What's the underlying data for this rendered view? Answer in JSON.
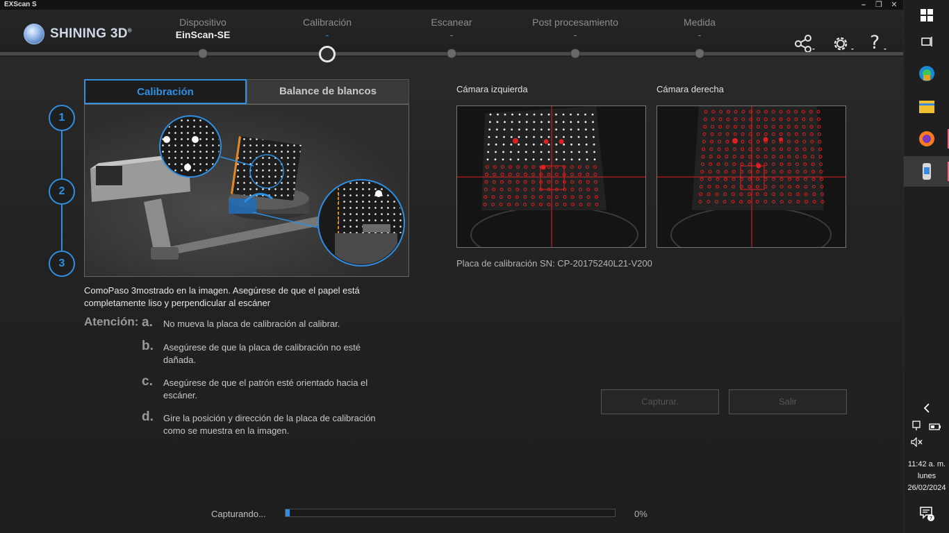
{
  "window": {
    "title": "EXScan S"
  },
  "header": {
    "brand": "SHINING 3D",
    "brand_mark": "®",
    "steps": [
      {
        "label": "Dispositivo",
        "value": "EinScan-SE"
      },
      {
        "label": "Calibración",
        "value": "-"
      },
      {
        "label": "Escanear",
        "value": "-"
      },
      {
        "label": "Post procesamiento",
        "value": "-"
      },
      {
        "label": "Medida",
        "value": "-"
      }
    ],
    "active_step": "Calibración",
    "icons": [
      "share-icon",
      "gear-icon",
      "help-icon"
    ]
  },
  "tabs": [
    {
      "label": "Calibración",
      "active": true
    },
    {
      "label": "Balance de blancos",
      "active": false
    }
  ],
  "step_numbers": [
    "1",
    "2",
    "3"
  ],
  "instruction": "ComoPaso 3mostrado en la imagen. Asegúrese de que el papel está completamente liso y perpendicular al escáner",
  "attention": {
    "label": "Atención:",
    "notes": [
      {
        "letter": "a.",
        "text": "No mueva la placa de calibración al calibrar."
      },
      {
        "letter": "b.",
        "text": "Asegúrese de que la placa de calibración no esté dañada."
      },
      {
        "letter": "c.",
        "text": "Asegúrese de que el patrón esté orientado hacia el escáner."
      },
      {
        "letter": "d.",
        "text": "Gire la posición y dirección de la placa de calibración como se muestra en la imagen."
      }
    ]
  },
  "cameras": {
    "left_label": "Cámara izquierda",
    "right_label": "Cámara derecha",
    "serial": "Placa de calibración SN: CP-20175240L21-V200"
  },
  "buttons": {
    "capture": "Capturar.",
    "exit": "Salir"
  },
  "progress": {
    "label": "Capturando...",
    "percent_text": "0%",
    "value": 0
  },
  "taskbar": {
    "icons": [
      "windows-start-icon",
      "task-view-icon",
      "edge-icon",
      "file-explorer-icon",
      "firefox-icon",
      "exscan-app-icon"
    ],
    "tray": [
      "chevron-left-icon",
      "network-icon",
      "battery-icon",
      "volume-muted-icon",
      "notification-icon"
    ],
    "time": "11:42 a. m.",
    "day": "lunes",
    "date": "26/02/2024",
    "notification_count": "7"
  },
  "colors": {
    "accent": "#2f8fe3",
    "marker": "#e02020"
  }
}
